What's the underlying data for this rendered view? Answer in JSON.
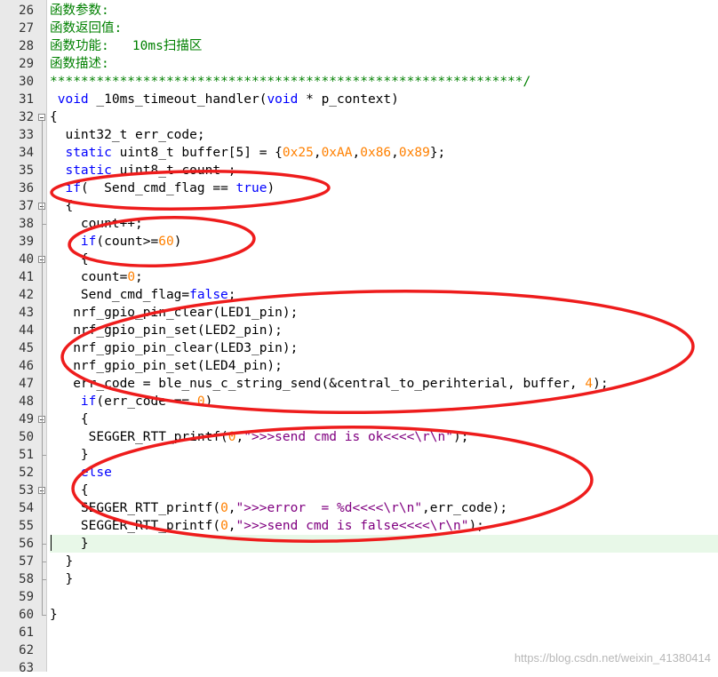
{
  "editor": {
    "current_line": 56,
    "lines": [
      {
        "n": "26",
        "fold": false,
        "t": [
          {
            "c": "comment",
            "s": "函数参数:"
          }
        ]
      },
      {
        "n": "27",
        "fold": false,
        "t": [
          {
            "c": "comment",
            "s": "函数返回值:"
          }
        ]
      },
      {
        "n": "28",
        "fold": false,
        "t": [
          {
            "c": "comment",
            "s": "函数功能:   10ms扫描区"
          }
        ]
      },
      {
        "n": "29",
        "fold": false,
        "t": [
          {
            "c": "comment",
            "s": "函数描述:"
          }
        ]
      },
      {
        "n": "30",
        "fold": false,
        "t": [
          {
            "c": "comment",
            "s": "*************************************************************/"
          }
        ]
      },
      {
        "n": "31",
        "fold": false,
        "t": [
          {
            "c": "plain",
            "s": " "
          },
          {
            "c": "kw",
            "s": "void"
          },
          {
            "c": "plain",
            "s": " _10ms_timeout_handler("
          },
          {
            "c": "kw",
            "s": "void"
          },
          {
            "c": "plain",
            "s": " * p_context)"
          }
        ]
      },
      {
        "n": "32",
        "fold": true,
        "t": [
          {
            "c": "plain",
            "s": "{"
          }
        ]
      },
      {
        "n": "33",
        "fold": false,
        "t": [
          {
            "c": "plain",
            "s": "  uint32_t err_code;"
          }
        ]
      },
      {
        "n": "34",
        "fold": false,
        "t": [
          {
            "c": "plain",
            "s": "  "
          },
          {
            "c": "kw",
            "s": "static"
          },
          {
            "c": "plain",
            "s": " uint8_t buffer[5] = {"
          },
          {
            "c": "num",
            "s": "0x25"
          },
          {
            "c": "plain",
            "s": ","
          },
          {
            "c": "num",
            "s": "0xAA"
          },
          {
            "c": "plain",
            "s": ","
          },
          {
            "c": "num",
            "s": "0x86"
          },
          {
            "c": "plain",
            "s": ","
          },
          {
            "c": "num",
            "s": "0x89"
          },
          {
            "c": "plain",
            "s": "};"
          }
        ]
      },
      {
        "n": "35",
        "fold": false,
        "t": [
          {
            "c": "plain",
            "s": "  "
          },
          {
            "c": "kw",
            "s": "static"
          },
          {
            "c": "plain",
            "s": " uint8_t count ;"
          }
        ]
      },
      {
        "n": "36",
        "fold": false,
        "t": [
          {
            "c": "plain",
            "s": "  "
          },
          {
            "c": "kw",
            "s": "if"
          },
          {
            "c": "plain",
            "s": "(  Send_cmd_flag == "
          },
          {
            "c": "kw",
            "s": "true"
          },
          {
            "c": "plain",
            "s": ")"
          }
        ]
      },
      {
        "n": "37",
        "fold": true,
        "t": [
          {
            "c": "plain",
            "s": "  {"
          }
        ]
      },
      {
        "n": "38",
        "fold": false,
        "t": [
          {
            "c": "plain",
            "s": "    count++;"
          }
        ]
      },
      {
        "n": "39",
        "fold": false,
        "t": [
          {
            "c": "plain",
            "s": "    "
          },
          {
            "c": "kw",
            "s": "if"
          },
          {
            "c": "plain",
            "s": "(count>="
          },
          {
            "c": "num",
            "s": "60"
          },
          {
            "c": "plain",
            "s": ")"
          }
        ]
      },
      {
        "n": "40",
        "fold": true,
        "t": [
          {
            "c": "plain",
            "s": "    {"
          }
        ]
      },
      {
        "n": "41",
        "fold": false,
        "t": [
          {
            "c": "plain",
            "s": "    count="
          },
          {
            "c": "num",
            "s": "0"
          },
          {
            "c": "plain",
            "s": ";"
          }
        ]
      },
      {
        "n": "42",
        "fold": false,
        "t": [
          {
            "c": "plain",
            "s": "    Send_cmd_flag="
          },
          {
            "c": "kw",
            "s": "false"
          },
          {
            "c": "plain",
            "s": ";"
          }
        ]
      },
      {
        "n": "43",
        "fold": false,
        "t": [
          {
            "c": "plain",
            "s": "   nrf_gpio_pin_clear(LED1_pin);"
          }
        ]
      },
      {
        "n": "44",
        "fold": false,
        "t": [
          {
            "c": "plain",
            "s": "   nrf_gpio_pin_set(LED2_pin);"
          }
        ]
      },
      {
        "n": "45",
        "fold": false,
        "t": [
          {
            "c": "plain",
            "s": "   nrf_gpio_pin_clear(LED3_pin);"
          }
        ]
      },
      {
        "n": "46",
        "fold": false,
        "t": [
          {
            "c": "plain",
            "s": "   nrf_gpio_pin_set(LED4_pin);"
          }
        ]
      },
      {
        "n": "47",
        "fold": false,
        "t": [
          {
            "c": "plain",
            "s": "   err_code = ble_nus_c_string_send(&central_to_perihterial, buffer, "
          },
          {
            "c": "num",
            "s": "4"
          },
          {
            "c": "plain",
            "s": ");"
          }
        ]
      },
      {
        "n": "48",
        "fold": false,
        "t": [
          {
            "c": "plain",
            "s": "    "
          },
          {
            "c": "kw",
            "s": "if"
          },
          {
            "c": "plain",
            "s": "(err_code == "
          },
          {
            "c": "num",
            "s": "0"
          },
          {
            "c": "plain",
            "s": ")"
          }
        ]
      },
      {
        "n": "49",
        "fold": true,
        "t": [
          {
            "c": "plain",
            "s": "    {"
          }
        ]
      },
      {
        "n": "50",
        "fold": false,
        "t": [
          {
            "c": "plain",
            "s": "     SEGGER_RTT_printf("
          },
          {
            "c": "num",
            "s": "0"
          },
          {
            "c": "plain",
            "s": ","
          },
          {
            "c": "str",
            "s": "\">>>send cmd is ok<<<<\\r\\n\""
          },
          {
            "c": "plain",
            "s": ");"
          }
        ]
      },
      {
        "n": "51",
        "fold": false,
        "t": [
          {
            "c": "plain",
            "s": "    }"
          }
        ]
      },
      {
        "n": "52",
        "fold": false,
        "t": [
          {
            "c": "plain",
            "s": "    "
          },
          {
            "c": "kw",
            "s": "else"
          }
        ]
      },
      {
        "n": "53",
        "fold": true,
        "t": [
          {
            "c": "plain",
            "s": "    {"
          }
        ]
      },
      {
        "n": "54",
        "fold": false,
        "t": [
          {
            "c": "plain",
            "s": "    SEGGER_RTT_printf("
          },
          {
            "c": "num",
            "s": "0"
          },
          {
            "c": "plain",
            "s": ","
          },
          {
            "c": "str",
            "s": "\">>>error  = %d<<<<\\r\\n\""
          },
          {
            "c": "plain",
            "s": ",err_code);"
          }
        ]
      },
      {
        "n": "55",
        "fold": false,
        "t": [
          {
            "c": "plain",
            "s": "    SEGGER_RTT_printf("
          },
          {
            "c": "num",
            "s": "0"
          },
          {
            "c": "plain",
            "s": ","
          },
          {
            "c": "str",
            "s": "\">>>send cmd is false<<<<\\r\\n\""
          },
          {
            "c": "plain",
            "s": ");"
          }
        ]
      },
      {
        "n": "56",
        "fold": false,
        "t": [
          {
            "c": "plain",
            "s": "    }"
          }
        ]
      },
      {
        "n": "57",
        "fold": false,
        "t": [
          {
            "c": "plain",
            "s": "  }"
          }
        ]
      },
      {
        "n": "58",
        "fold": false,
        "t": [
          {
            "c": "plain",
            "s": "  }"
          }
        ]
      },
      {
        "n": "59",
        "fold": false,
        "t": []
      },
      {
        "n": "60",
        "fold": false,
        "t": [
          {
            "c": "plain",
            "s": "}"
          }
        ]
      },
      {
        "n": "61",
        "fold": false,
        "t": []
      },
      {
        "n": "62",
        "fold": false,
        "t": []
      },
      {
        "n": "63",
        "fold": false,
        "t": []
      }
    ]
  },
  "colors": {
    "comment": "#008000",
    "keyword": "#0000ff",
    "number": "#ff8000",
    "string": "#800080",
    "annotation": "#ee1c1c",
    "current_line_bg": "#e8f8e8",
    "gutter_bg": "#e9e9e9"
  },
  "watermark": "https://blog.csdn.net/weixin_41380414"
}
